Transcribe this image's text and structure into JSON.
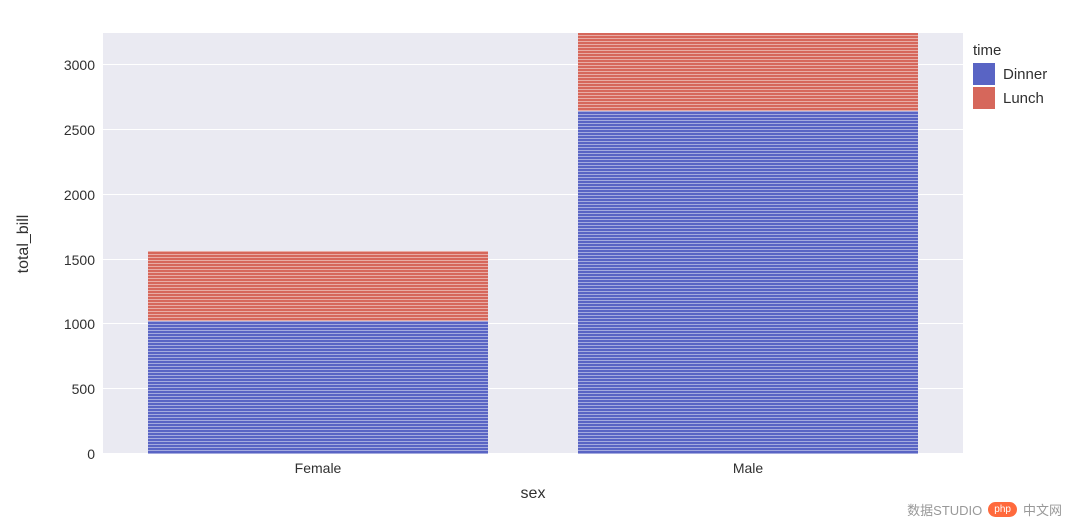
{
  "chart_data": {
    "type": "bar",
    "stacked": true,
    "categories": [
      "Female",
      "Male"
    ],
    "series": [
      {
        "name": "Dinner",
        "values": [
          1025,
          2650
        ],
        "color": "#5964c4"
      },
      {
        "name": "Lunch",
        "values": [
          545,
          600
        ],
        "color": "#d6675b"
      }
    ],
    "title": "",
    "xlabel": "sex",
    "ylabel": "total_bill",
    "ylim": [
      0,
      3250
    ],
    "yticks": [
      0,
      500,
      1000,
      1500,
      2000,
      2500,
      3000
    ],
    "grid": true,
    "legend_title": "time",
    "legend_position": "right"
  },
  "legend": {
    "title": "time",
    "items": [
      {
        "label": "Dinner",
        "color": "#5964c4"
      },
      {
        "label": "Lunch",
        "color": "#d6675b"
      }
    ]
  },
  "yticks": {
    "t0": "0",
    "t1": "500",
    "t2": "1000",
    "t3": "1500",
    "t4": "2000",
    "t5": "2500",
    "t6": "3000"
  },
  "xticks": {
    "c0": "Female",
    "c1": "Male"
  },
  "xlabel": "sex",
  "ylabel": "total_bill",
  "watermark": {
    "left": "数据STUDIO",
    "badge": "php",
    "right": "中文网"
  }
}
